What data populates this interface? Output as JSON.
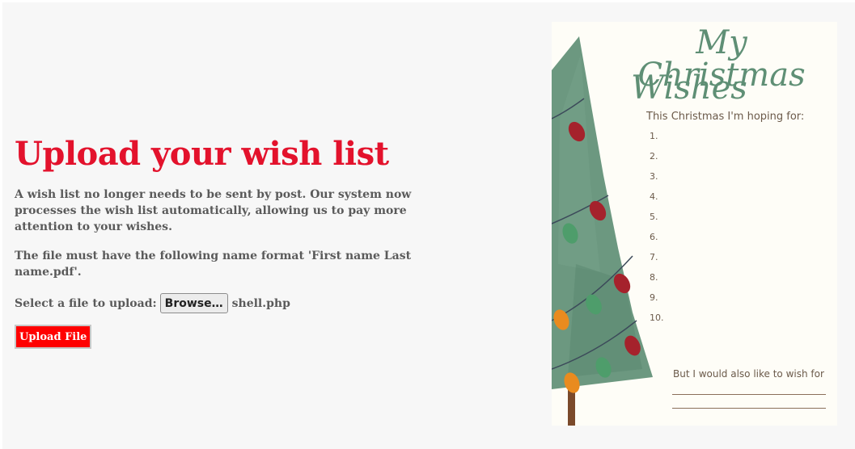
{
  "main": {
    "heading": "Upload your wish list",
    "intro": "A wish list no longer needs to be sent by post. Our system now processes the wish list automatically, allowing us to pay more attention to your wishes.",
    "format_note": "The file must have the following name format 'First name Last name.pdf'.",
    "upload_label": "Select a file to upload:",
    "browse_label": "Browse…",
    "selected_file": "shell.php",
    "submit_label": "Upload File"
  },
  "card": {
    "title_line1": "My Christmas",
    "title_line2": "Wishes",
    "hoping": "This Christmas I'm hoping for:",
    "items": [
      "1.",
      "2.",
      "3.",
      "4.",
      "5.",
      "6.",
      "7.",
      "8.",
      "9.",
      "10."
    ],
    "also": "But I would also like to wish for"
  },
  "colors": {
    "heading": "#e3122c",
    "button": "#ff0000",
    "tree": "#5f8f75",
    "card_bg": "#fefdf7"
  }
}
